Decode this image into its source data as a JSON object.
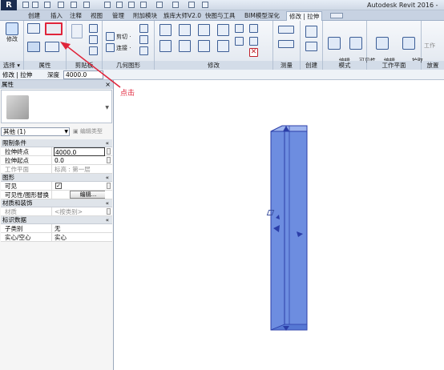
{
  "window": {
    "title": "Autodesk Revit 2016 -"
  },
  "app_button": "R",
  "tabs": [
    {
      "label": "创建",
      "active": false
    },
    {
      "label": "插入",
      "active": false
    },
    {
      "label": "注释",
      "active": false
    },
    {
      "label": "视图",
      "active": false
    },
    {
      "label": "管理",
      "active": false
    },
    {
      "label": "附加模块",
      "active": false
    },
    {
      "label": "族库大师V2.0",
      "active": false
    },
    {
      "label": "快图与工具",
      "active": false
    },
    {
      "label": "BIM模型深化",
      "active": false
    },
    {
      "label": "修改 | 拉伸",
      "active": true
    }
  ],
  "ribbon": {
    "modify_label": "修改",
    "select_panel": "选择 ▾",
    "properties_panel": "属性",
    "clipboard_panel": "剪贴板",
    "geometry_panel": "几何图形",
    "modify_panel": "修改",
    "measure_panel": "测量",
    "create_panel": "创建",
    "mode_panel": "模式",
    "workplane_panel": "工作平面",
    "cut_label": "剪切 ·",
    "join_label": "连接 ·",
    "edit_extrusion": "编辑\n拉伸",
    "visibility_settings": "可见性\n设置",
    "edit_workplane": "编辑\n工作平面",
    "pick_new": "拾取\n新的",
    "place_label": "放置",
    "work_label": "工作"
  },
  "options_bar": {
    "context": "修改 | 拉伸",
    "depth_label": "深度",
    "depth_value": "4000.0"
  },
  "properties": {
    "header": "属性",
    "close": "×",
    "type_filter": "其他 (1)",
    "edit_type": "编辑类型",
    "sections": [
      {
        "title": "限制条件",
        "rows": [
          {
            "name": "拉伸终点",
            "value": "4000.0"
          },
          {
            "name": "拉伸起点",
            "value": "0.0"
          },
          {
            "name": "工作平面",
            "value": "标高 : 第一层"
          }
        ]
      },
      {
        "title": "图形",
        "rows": [
          {
            "name": "可见",
            "value": "✓"
          },
          {
            "name": "可见性/图形替换",
            "value": "编辑..."
          }
        ]
      },
      {
        "title": "材质和装饰",
        "rows": [
          {
            "name": "材质",
            "value": "<按类别>"
          }
        ]
      },
      {
        "title": "标识数据",
        "rows": [
          {
            "name": "子类别",
            "value": "无"
          },
          {
            "name": "实心/空心",
            "value": "实心"
          }
        ]
      }
    ],
    "chevron": "«"
  },
  "annotation": "点击",
  "colors": {
    "column_fill": "#6d8de0",
    "column_stroke": "#2b3ea8",
    "arrow": "#e0243a"
  }
}
